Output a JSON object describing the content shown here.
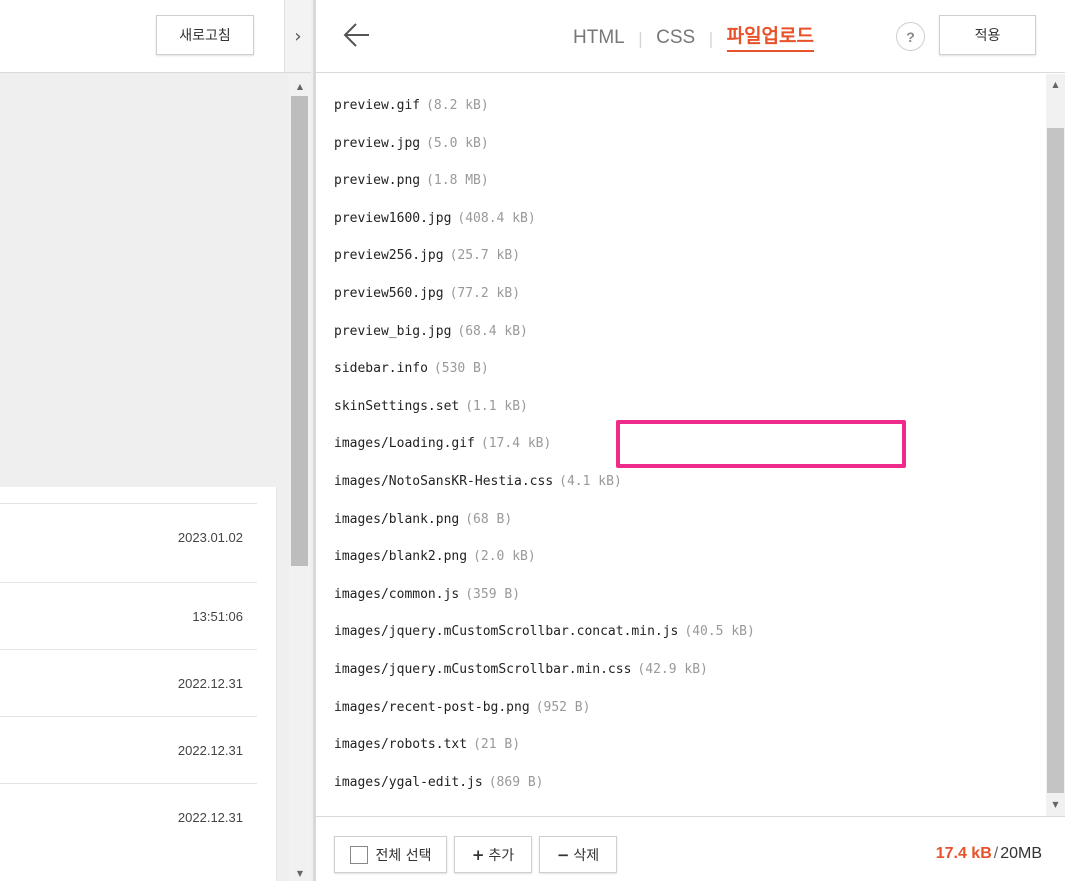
{
  "left_panel": {
    "refresh_label": "새로고침",
    "collapse_toggle": "›",
    "rows": [
      {
        "date": "2023.01.02"
      },
      {
        "date": "13:51:06"
      },
      {
        "date": "2022.12.31"
      },
      {
        "date": "2022.12.31"
      },
      {
        "date": "2022.12.31"
      }
    ]
  },
  "header": {
    "back_icon": "arrow-left-icon",
    "tabs": [
      {
        "label": "HTML"
      },
      {
        "label": "CSS"
      },
      {
        "label": "파일업로드"
      }
    ],
    "active_tab": "파일업로드",
    "help_label": "?",
    "apply_label": "적용"
  },
  "files": [
    {
      "name": "preview.gif",
      "size": "(8.2 kB)"
    },
    {
      "name": "preview.jpg",
      "size": "(5.0 kB)"
    },
    {
      "name": "preview.png",
      "size": "(1.8 MB)"
    },
    {
      "name": "preview1600.jpg",
      "size": "(408.4 kB)"
    },
    {
      "name": "preview256.jpg",
      "size": "(25.7 kB)"
    },
    {
      "name": "preview560.jpg",
      "size": "(77.2 kB)"
    },
    {
      "name": "preview_big.jpg",
      "size": "(68.4 kB)"
    },
    {
      "name": "sidebar.info",
      "size": "(530 B)"
    },
    {
      "name": "skinSettings.set",
      "size": "(1.1 kB)"
    },
    {
      "name": "images/Loading.gif",
      "size": "(17.4 kB)"
    },
    {
      "name": "images/NotoSansKR-Hestia.css",
      "size": "(4.1 kB)"
    },
    {
      "name": "images/blank.png",
      "size": "(68 B)"
    },
    {
      "name": "images/blank2.png",
      "size": "(2.0 kB)"
    },
    {
      "name": "images/common.js",
      "size": "(359 B)"
    },
    {
      "name": "images/jquery.mCustomScrollbar.concat.min.js",
      "size": "(40.5 kB)"
    },
    {
      "name": "images/jquery.mCustomScrollbar.min.css",
      "size": "(42.9 kB)"
    },
    {
      "name": "images/recent-post-bg.png",
      "size": "(952 B)"
    },
    {
      "name": "images/robots.txt",
      "size": "(21 B)"
    },
    {
      "name": "images/ygal-edit.js",
      "size": "(869 B)"
    }
  ],
  "highlighted_file": "images/Loading.gif",
  "footer": {
    "select_all_label": "전체 선택",
    "add_symbol": "+",
    "add_label": "추가",
    "delete_symbol": "−",
    "delete_label": "삭제",
    "used": "17.4 kB",
    "separator": "/",
    "total": "20MB"
  },
  "colors": {
    "accent": "#e8522a",
    "highlight": "#ee2a8a"
  }
}
